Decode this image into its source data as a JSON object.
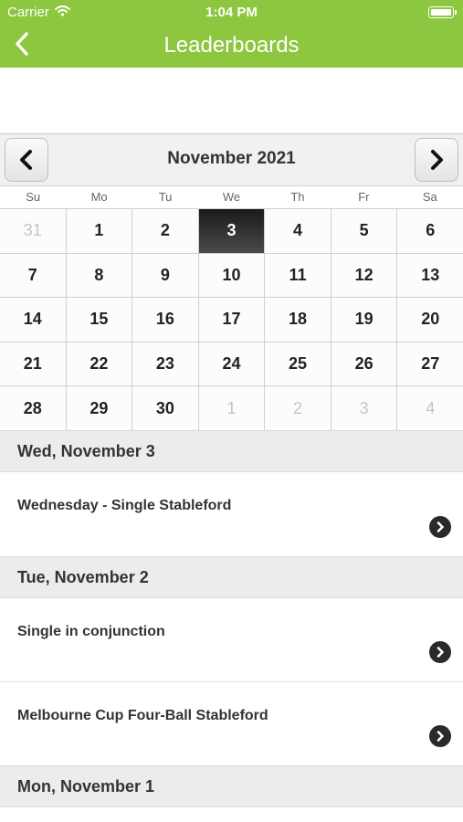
{
  "status": {
    "carrier": "Carrier",
    "time": "1:04 PM"
  },
  "nav": {
    "title": "Leaderboards",
    "back_icon": "chevron-left-icon"
  },
  "calendar": {
    "month_title": "November 2021",
    "weekdays": [
      "Su",
      "Mo",
      "Tu",
      "We",
      "Th",
      "Fr",
      "Sa"
    ],
    "days": [
      {
        "d": "31",
        "other": true
      },
      {
        "d": "1"
      },
      {
        "d": "2"
      },
      {
        "d": "3",
        "selected": true
      },
      {
        "d": "4"
      },
      {
        "d": "5"
      },
      {
        "d": "6"
      },
      {
        "d": "7"
      },
      {
        "d": "8"
      },
      {
        "d": "9"
      },
      {
        "d": "10"
      },
      {
        "d": "11"
      },
      {
        "d": "12"
      },
      {
        "d": "13"
      },
      {
        "d": "14"
      },
      {
        "d": "15"
      },
      {
        "d": "16"
      },
      {
        "d": "17"
      },
      {
        "d": "18"
      },
      {
        "d": "19"
      },
      {
        "d": "20"
      },
      {
        "d": "21"
      },
      {
        "d": "22"
      },
      {
        "d": "23"
      },
      {
        "d": "24"
      },
      {
        "d": "25"
      },
      {
        "d": "26"
      },
      {
        "d": "27"
      },
      {
        "d": "28"
      },
      {
        "d": "29"
      },
      {
        "d": "30"
      },
      {
        "d": "1",
        "other": true
      },
      {
        "d": "2",
        "other": true
      },
      {
        "d": "3",
        "other": true
      },
      {
        "d": "4",
        "other": true
      }
    ]
  },
  "list": {
    "sections": [
      {
        "header": "Wed, November 3",
        "items": [
          "Wednesday - Single Stableford"
        ]
      },
      {
        "header": "Tue, November 2",
        "items": [
          "Single in conjunction",
          "Melbourne Cup Four-Ball Stableford"
        ]
      },
      {
        "header": "Mon, November 1",
        "items": []
      }
    ]
  },
  "colors": {
    "accent": "#8dc63f",
    "selected_day": "#2b2b2b"
  }
}
